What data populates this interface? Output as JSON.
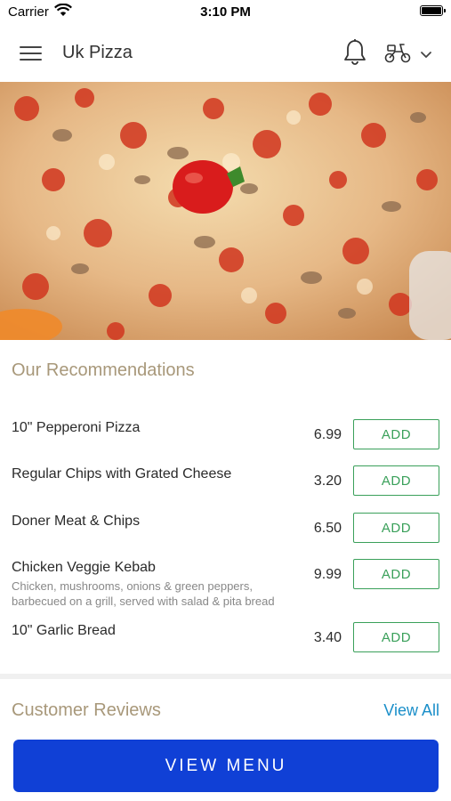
{
  "status_bar": {
    "carrier": "Carrier",
    "time": "3:10 PM"
  },
  "header": {
    "title": "Uk Pizza",
    "icons": [
      "menu-icon",
      "bell-icon",
      "delivery-scooter-icon",
      "chevron-down-icon"
    ]
  },
  "recommendations": {
    "title": "Our Recommendations",
    "items": [
      {
        "name": "10\" Pepperoni Pizza",
        "description": "",
        "price": "6.99",
        "button": "ADD"
      },
      {
        "name": "Regular Chips with Grated Cheese",
        "description": "",
        "price": "3.20",
        "button": "ADD"
      },
      {
        "name": "Doner Meat & Chips",
        "description": "",
        "price": "6.50",
        "button": "ADD"
      },
      {
        "name": "Chicken Veggie Kebab",
        "description": "Chicken, mushrooms, onions & green peppers, barbecued on a grill, served with salad & pita bread",
        "price": "9.99",
        "button": "ADD"
      },
      {
        "name": "10\" Garlic Bread",
        "description": "",
        "price": "3.40",
        "button": "ADD"
      }
    ]
  },
  "reviews": {
    "title": "Customer Reviews",
    "view_all": "View All"
  },
  "footer": {
    "view_menu": "VIEW MENU"
  },
  "colors": {
    "accent_gold": "#a8987a",
    "add_green": "#3aa05a",
    "link_blue": "#1b8fc9",
    "button_blue": "#1040d6"
  }
}
